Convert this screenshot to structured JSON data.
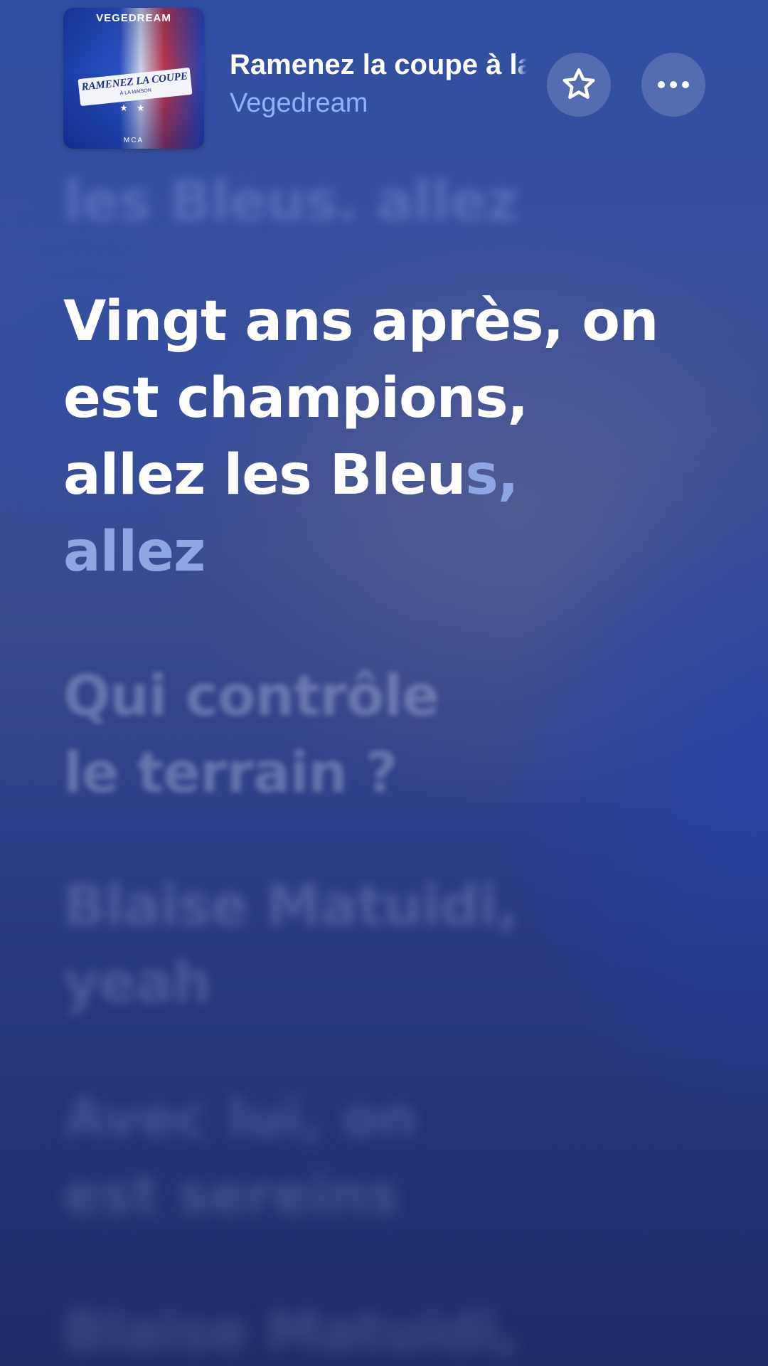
{
  "now_playing": {
    "title": "Ramenez la coupe à la maison",
    "artist": "Vegedream",
    "artwork": {
      "artist_text": "VEGEDREAM",
      "title_text": "RAMENEZ LA COUPE",
      "subtitle_text": "À LA MAISON",
      "stars": "★ ★",
      "logos_text": "MCA",
      "colors": [
        "#1e3fa8",
        "#ffffff",
        "#d8343a"
      ]
    }
  },
  "controls": {
    "favorite_icon": "star-outline-icon",
    "more_icon": "ellipsis-icon"
  },
  "lyrics": {
    "previous_line": "les Bleus, allez",
    "active_line_sung": "Vingt ans après, on\nest champions,\nallez les Bleu",
    "active_line_unsung": "s,\nallez",
    "upcoming": [
      "Qui contrôle\nle terrain ?",
      "Blaise Matuidi,\nyeah",
      "Avec lui, on\nest sereins",
      "Blaise Matuidi,"
    ]
  },
  "colors": {
    "active_lyric": "#ffffff",
    "unsung_lyric": "#8ea6e4",
    "artist_accent": "#8fb2ff",
    "background_top": "#2f4fa3",
    "background_bottom": "#1f2c68"
  }
}
